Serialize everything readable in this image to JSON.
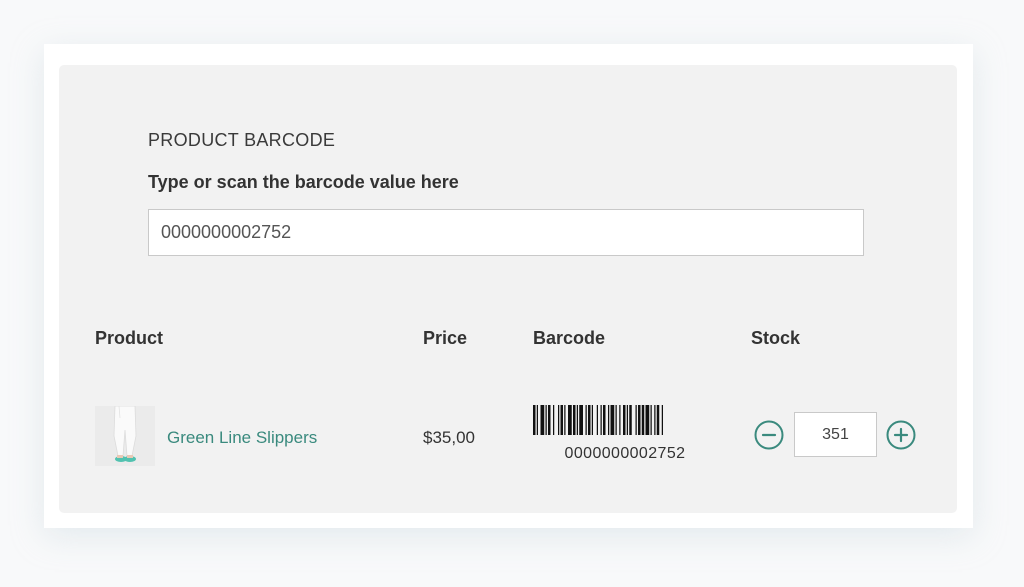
{
  "barcode_section": {
    "title": "PRODUCT BARCODE",
    "label": "Type or scan the barcode value here",
    "input_value": "0000000002752"
  },
  "table": {
    "headers": [
      "Product",
      "Price",
      "Barcode",
      "Stock"
    ],
    "rows": [
      {
        "product_name": "Green Line Slippers",
        "thumbnail": "product-thumbnail",
        "price": "$35,00",
        "barcode": "0000000002752",
        "stock": "351"
      }
    ]
  },
  "icons": {
    "minus": "minus-circle-icon",
    "plus": "plus-circle-icon"
  },
  "colors": {
    "accent": "#3a8a7e",
    "panel_bg": "#f2f2f2",
    "text": "#333333"
  }
}
